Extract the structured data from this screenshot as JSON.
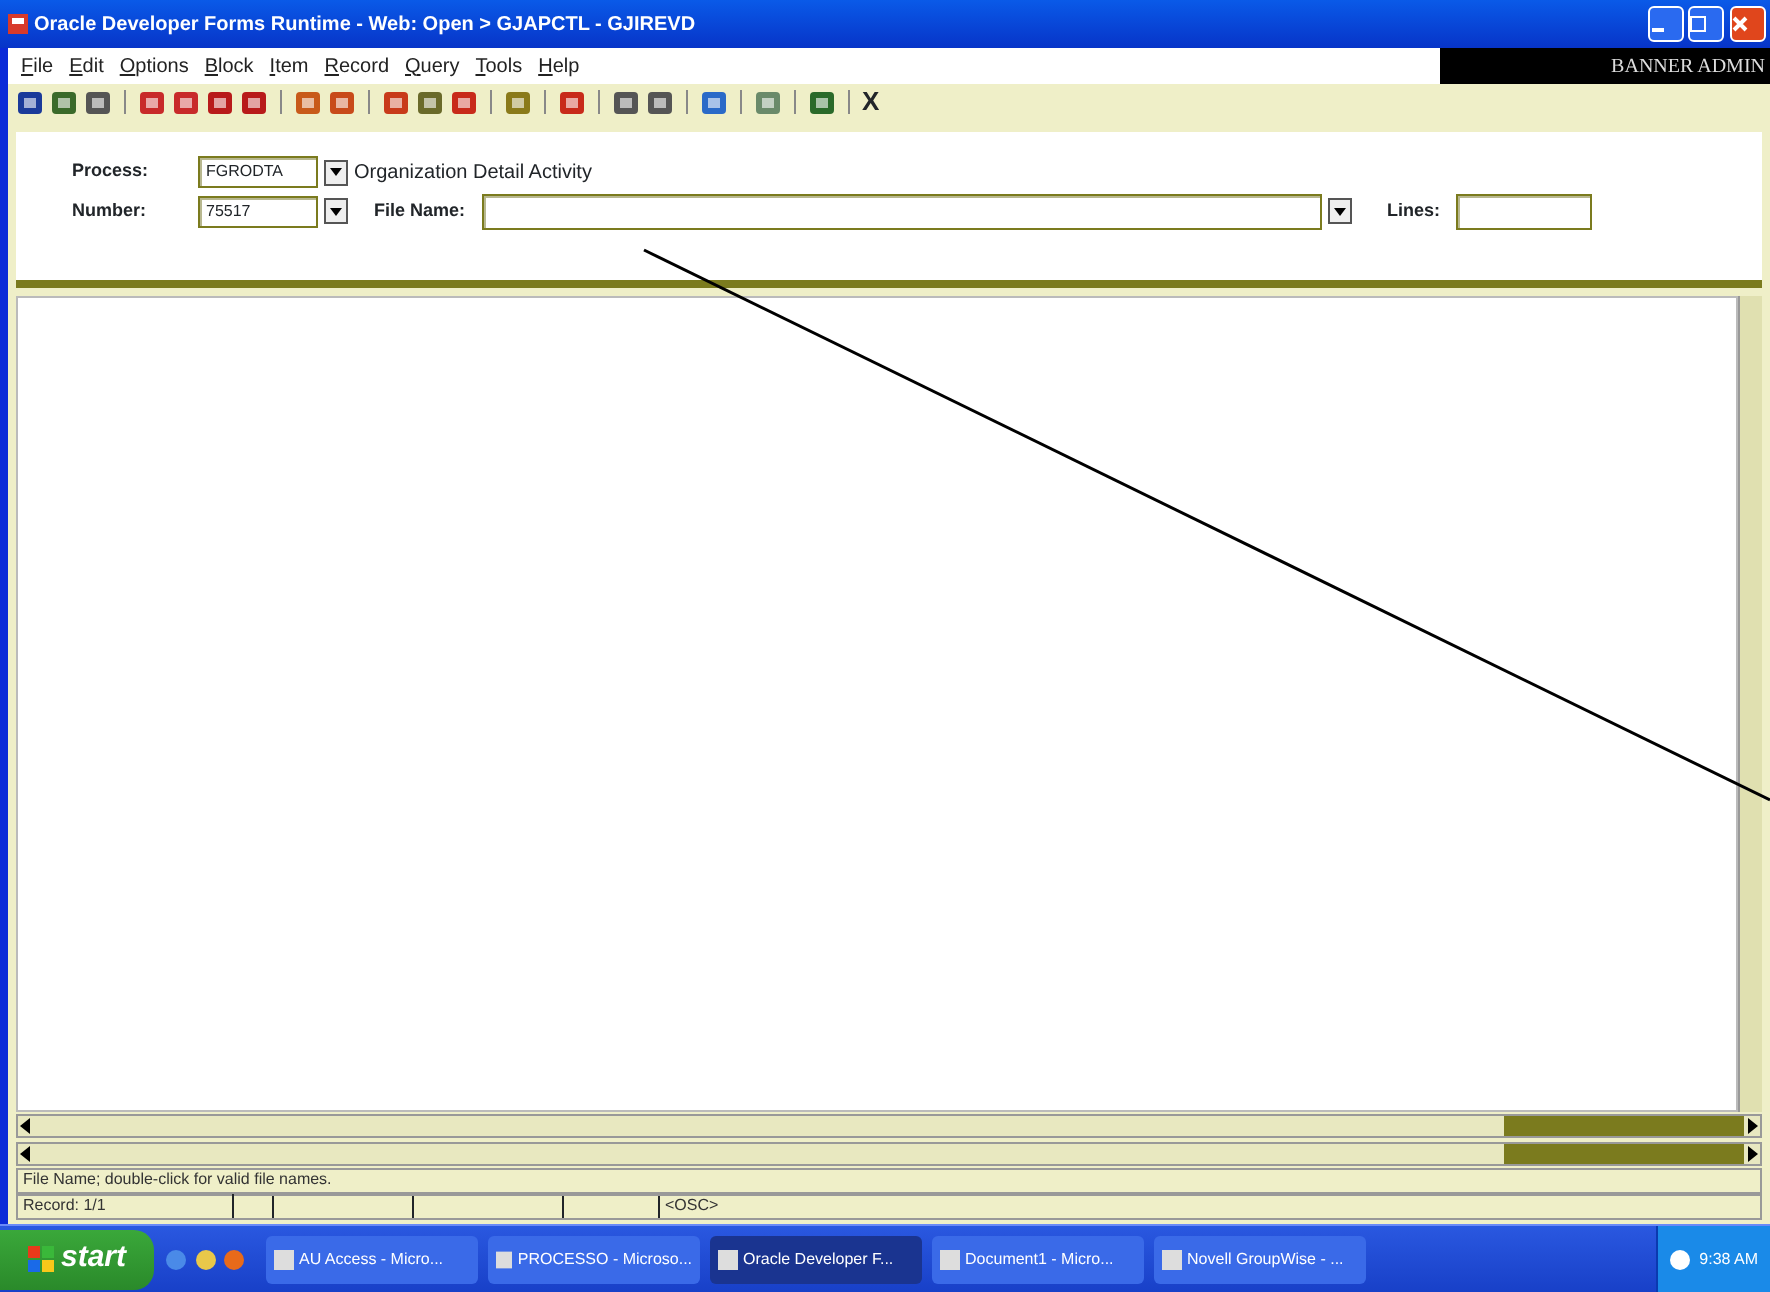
{
  "window": {
    "title": "Oracle Developer Forms Runtime - Web:  Open > GJAPCTL - GJIREVD"
  },
  "menu": [
    "File",
    "Edit",
    "Options",
    "Block",
    "Item",
    "Record",
    "Query",
    "Tools",
    "Help"
  ],
  "banner": "BANNER ADMIN",
  "toolbar": {
    "exit_label": "X"
  },
  "form": {
    "process": {
      "label": "Process:",
      "value": "FGRODTA",
      "description": "Organization Detail Activity"
    },
    "number": {
      "label": "Number:",
      "value": "75517"
    },
    "file_name": {
      "label": "File Name:"
    },
    "lines": {
      "label": "Lines:"
    }
  },
  "status": {
    "hint": "File Name; double-click for valid file names.",
    "record": "Record: 1/1",
    "mode": "<OSC>"
  },
  "taskbar": {
    "start": "start",
    "tasks": [
      {
        "label": "AU Access - Micro...",
        "selected": false
      },
      {
        "label": "PROCESSO - Microso...",
        "selected": false
      },
      {
        "label": "Oracle Developer F...",
        "selected": true
      },
      {
        "label": "Document1 - Micro...",
        "selected": false
      },
      {
        "label": "Novell GroupWise - ...",
        "selected": false
      }
    ],
    "clock": "9:38 AM"
  }
}
